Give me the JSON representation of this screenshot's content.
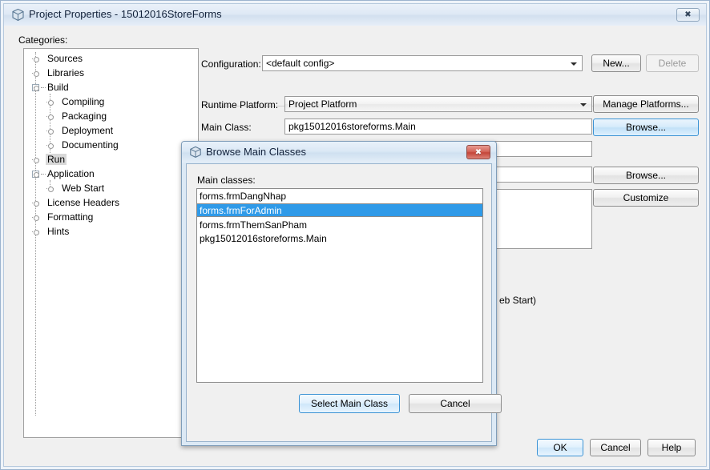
{
  "main_window": {
    "title": "Project Properties - 15012016StoreForms",
    "title_icon": "box-icon",
    "close_icon": "close-icon",
    "categories_label": "Categories:",
    "tree": [
      {
        "label": "Sources",
        "level": 0,
        "selected": false,
        "expander": false
      },
      {
        "label": "Libraries",
        "level": 0,
        "selected": false,
        "expander": false
      },
      {
        "label": "Build",
        "level": 0,
        "selected": false,
        "expander": true
      },
      {
        "label": "Compiling",
        "level": 1,
        "selected": false,
        "expander": false
      },
      {
        "label": "Packaging",
        "level": 1,
        "selected": false,
        "expander": false
      },
      {
        "label": "Deployment",
        "level": 1,
        "selected": false,
        "expander": false
      },
      {
        "label": "Documenting",
        "level": 1,
        "selected": false,
        "expander": false
      },
      {
        "label": "Run",
        "level": 0,
        "selected": true,
        "expander": false
      },
      {
        "label": "Application",
        "level": 0,
        "selected": false,
        "expander": true
      },
      {
        "label": "Web Start",
        "level": 1,
        "selected": false,
        "expander": false
      },
      {
        "label": "License Headers",
        "level": 0,
        "selected": false,
        "expander": false
      },
      {
        "label": "Formatting",
        "level": 0,
        "selected": false,
        "expander": false
      },
      {
        "label": "Hints",
        "level": 0,
        "selected": false,
        "expander": false
      }
    ],
    "fields": {
      "configuration_label": "Configuration:",
      "configuration_value": "<default config>",
      "runtime_platform_label": "Runtime Platform:",
      "runtime_platform_value": "Project Platform",
      "main_class_label": "Main Class:",
      "main_class_value": "pkg15012016storeforms.Main"
    },
    "buttons": {
      "new": "New...",
      "delete": "Delete",
      "manage_platforms": "Manage Platforms...",
      "browse_main_class": "Browse...",
      "browse_working_dir": "Browse...",
      "customize": "Customize",
      "ok": "OK",
      "cancel": "Cancel",
      "help": "Help"
    },
    "partial_text": "eb Start)"
  },
  "dialog": {
    "title": "Browse Main Classes",
    "title_icon": "box-icon",
    "close_icon": "close-icon",
    "list_label": "Main classes:",
    "items": [
      {
        "label": "forms.frmDangNhap",
        "selected": false
      },
      {
        "label": "forms.frmForAdmin",
        "selected": true
      },
      {
        "label": "forms.frmThemSanPham",
        "selected": false
      },
      {
        "label": "pkg15012016storeforms.Main",
        "selected": false
      }
    ],
    "buttons": {
      "select": "Select Main Class",
      "cancel": "Cancel"
    }
  },
  "colors": {
    "selection_blue": "#2f9ae8",
    "focus_blue": "#3c93d4",
    "close_red": "#c4463a"
  }
}
